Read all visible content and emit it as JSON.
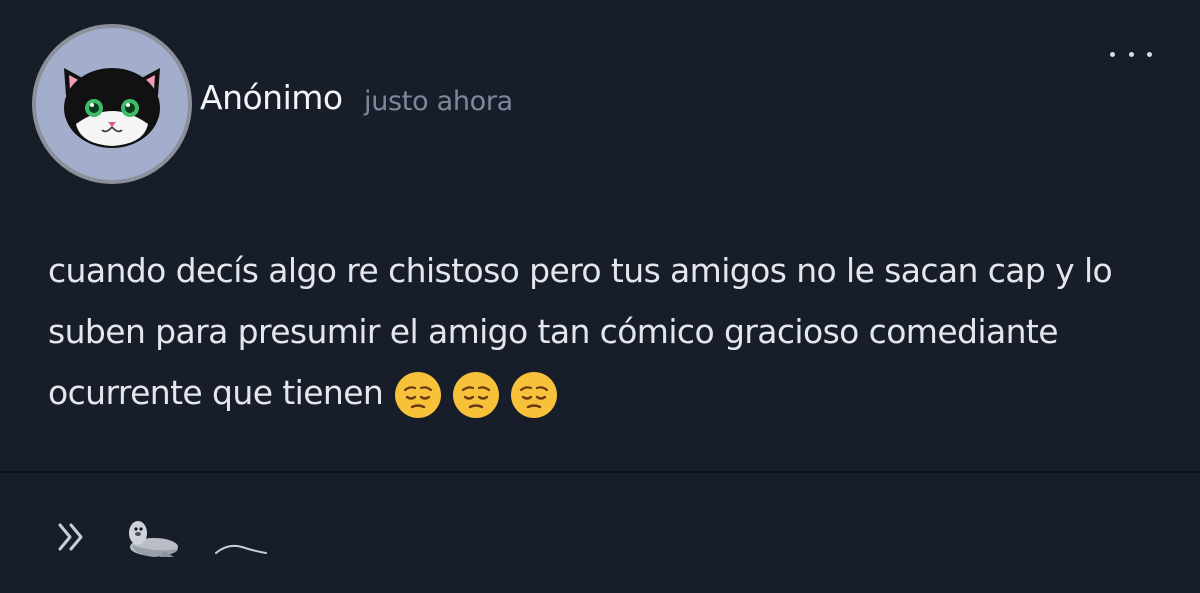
{
  "post": {
    "author": "Anónimo",
    "timestamp": "justo ahora",
    "body": "cuando decís algo re chistoso pero tus amigos no le sacan cap y lo suben para presumir el amigo tan cómico gracioso comediante ocurrente que tienen",
    "emojis": [
      "pensive-face",
      "pensive-face",
      "pensive-face"
    ],
    "avatar": "cat-face-avatar"
  },
  "footer": {
    "icons": [
      "double-chevron-right-icon",
      "seal-icon",
      "wave-line-icon"
    ]
  },
  "colors": {
    "background": "#171d29",
    "avatar_bg": "#a3aecd",
    "timestamp": "#7d889a",
    "text": "#e3e6ec"
  }
}
